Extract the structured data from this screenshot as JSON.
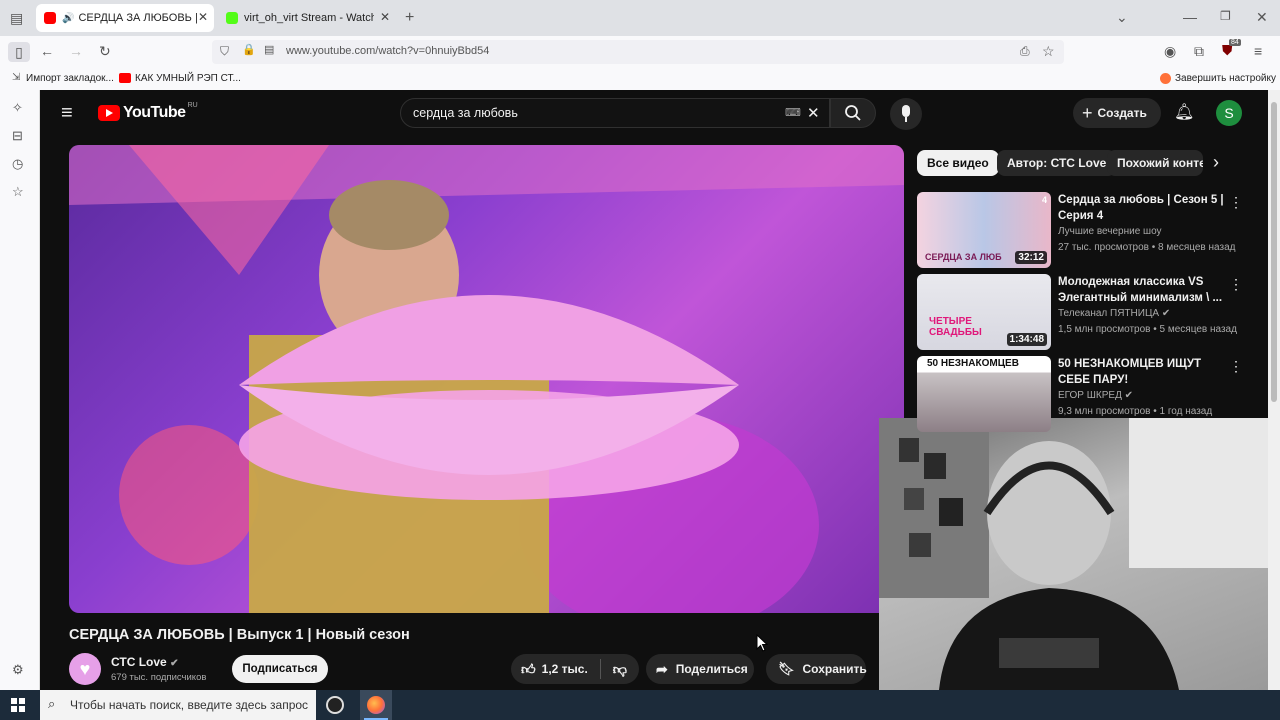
{
  "browser": {
    "tabs": [
      {
        "label": "СЕРДЦА ЗА ЛЮБОВЬ | Вып",
        "close": "✕"
      },
      {
        "label": "virt_oh_virt Stream - Watch Live",
        "close": "✕"
      }
    ],
    "new_tab": "+",
    "url": "www.youtube.com/watch?v=0hnuiyBbd54",
    "bookmarks": [
      "Импорт закладок...",
      "КАК УМНЫЙ РЭП СТ..."
    ],
    "finish_setup": "Завершить настройку",
    "badge_count": "84"
  },
  "youtube": {
    "logo_text": "YouTube",
    "logo_region": "RU",
    "search_value": "сердца за любовь",
    "create_label": "Создать",
    "avatar_letter": "S",
    "chips": [
      "Все видео",
      "Автор: СТС Love",
      "Похожий конте"
    ],
    "video_title": "СЕРДЦА ЗА ЛЮБОВЬ | Выпуск 1 | Новый сезон",
    "channel_name": "СТС Love",
    "subscribers": "679 тыс. подписчиков",
    "subscribe_label": "Подписаться",
    "likes": "1,2 тыс.",
    "share_label": "Поделиться",
    "save_label": "Сохранить",
    "recommendations": [
      {
        "title": "Сердца за любовь | Сезон 5 | Серия 4",
        "channel": "Лучшие вечерние шоу",
        "meta": "27 тыс. просмотров • 8 месяцев назад",
        "duration": "32:12",
        "thumb_text": "СЕРДЦА ЗА ЛЮБ",
        "badge": "4"
      },
      {
        "title": "Молодежная классика VS Элегантный минимализм \\ ...",
        "channel": "Телеканал ПЯТНИЦА",
        "meta": "1,5 млн просмотров • 5 месяцев назад",
        "duration": "1:34:48",
        "thumb_text": "ЧЕТЫРЕ СВАДЬБЫ"
      },
      {
        "title": "50 НЕЗНАКОМЦЕВ ИЩУТ СЕБЕ ПАРУ!",
        "channel": "ЕГОР ШКРЕД",
        "meta": "9,3 млн просмотров • 1 год назад",
        "thumb_text": "50 НЕЗНАКОМЦЕВ"
      }
    ]
  },
  "taskbar": {
    "search_placeholder": "Чтобы начать поиск, введите здесь запрос"
  },
  "colors": {
    "yt_bg": "#0f0f0f",
    "yt_red": "#ff0000",
    "accent_purple": "#8b2fc9",
    "avatar_green": "#1e8e3e"
  }
}
